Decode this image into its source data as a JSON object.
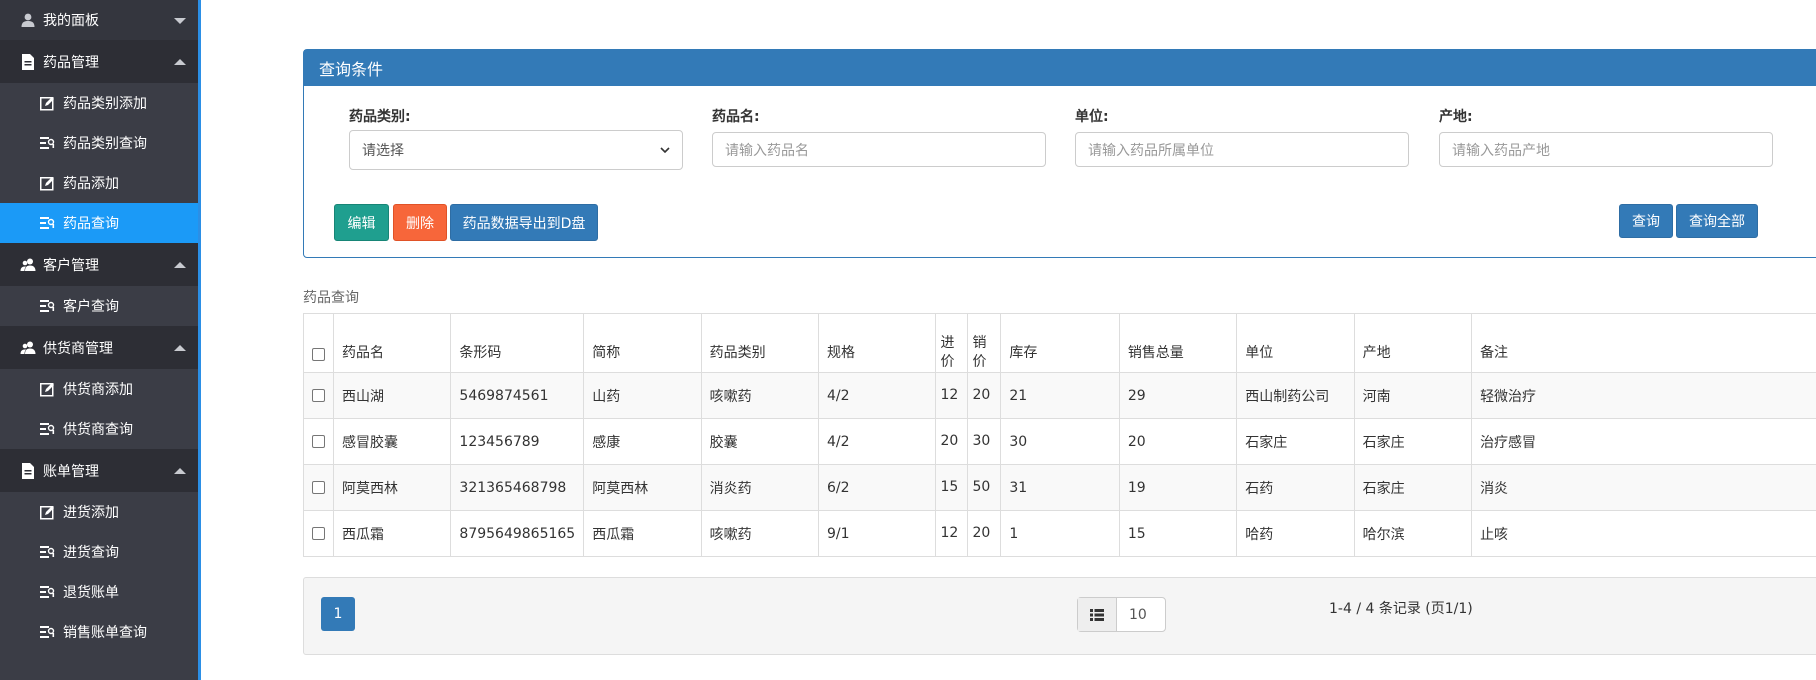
{
  "sidebar": {
    "dashboard": "我的面板",
    "groups": [
      {
        "label": "药品管理",
        "items": [
          "药品类别添加",
          "药品类别查询",
          "药品添加",
          "药品查询"
        ]
      },
      {
        "label": "客户管理",
        "items": [
          "客户查询"
        ]
      },
      {
        "label": "供货商管理",
        "items": [
          "供货商添加",
          "供货商查询"
        ]
      },
      {
        "label": "账单管理",
        "items": [
          "进货添加",
          "进货查询",
          "退货账单",
          "销售账单查询"
        ]
      }
    ],
    "active_item": "药品查询"
  },
  "query_panel": {
    "title": "查询条件",
    "category_label": "药品类别:",
    "category_selected": "请选择",
    "name_label": "药品名:",
    "name_placeholder": "请输入药品名",
    "unit_label": "单位:",
    "unit_placeholder": "请输入药品所属单位",
    "origin_label": "产地:",
    "origin_placeholder": "请输入药品产地",
    "edit_btn": "编辑",
    "delete_btn": "删除",
    "export_btn": "药品数据导出到D盘",
    "query_btn": "查询",
    "query_all_btn": "查询全部"
  },
  "table": {
    "caption": "药品查询",
    "headers": [
      "药品名",
      "条形码",
      "简称",
      "药品类别",
      "规格",
      "进价",
      "销价",
      "库存",
      "销售总量",
      "单位",
      "产地",
      "备注"
    ],
    "header_split": {
      "purchase": [
        "进",
        "价"
      ],
      "sale": [
        "销",
        "价"
      ]
    },
    "rows": [
      [
        "西山湖",
        "5469874561",
        "山药",
        "咳嗽药",
        "4/2",
        "12",
        "20",
        "21",
        "29",
        "西山制药公司",
        "河南",
        "轻微治疗"
      ],
      [
        "感冒胶囊",
        "123456789",
        "感康",
        "胶囊",
        "4/2",
        "20",
        "30",
        "30",
        "20",
        "石家庄",
        "石家庄",
        "治疗感冒"
      ],
      [
        "阿莫西林",
        "321365468798",
        "阿莫西林",
        "消炎药",
        "6/2",
        "15",
        "50",
        "31",
        "19",
        "石药",
        "石家庄",
        "消炎"
      ],
      [
        "西瓜霜",
        "8795649865165",
        "西瓜霜",
        "咳嗽药",
        "9/1",
        "12",
        "20",
        "1",
        "15",
        "哈药",
        "哈尔滨",
        "止咳"
      ]
    ]
  },
  "pagination": {
    "current_page": "1",
    "page_size": "10",
    "info": "1-4 / 4 条记录 (页1/1)"
  },
  "colors": {
    "sidebar_bg": "#3b3d46",
    "active": "#1b9af7",
    "primary": "#337ab7",
    "teal": "#1f9f8f",
    "orange": "#f7663a"
  }
}
